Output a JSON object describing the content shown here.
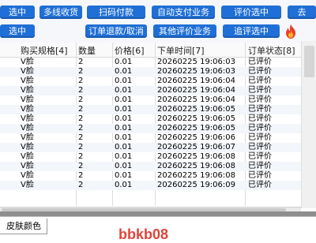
{
  "toolbar": {
    "row1": [
      "选中",
      "多线收货",
      "扫码付款",
      "自动支付业务",
      "评价选中",
      "去"
    ],
    "row2": [
      "选中",
      "订单退款/取消",
      "其他评价业务",
      "追评选中"
    ]
  },
  "table": {
    "columns": [
      "购买规格[4]",
      "数量",
      "价格[6]",
      "下单时间[7]",
      "订单状态[8]"
    ],
    "rows": [
      [
        "V脸",
        "2",
        "0.01",
        "20260225 19:06:03",
        "已评价"
      ],
      [
        "V脸",
        "2",
        "0.01",
        "20260225 19:06:03",
        "已评价"
      ],
      [
        "V脸",
        "2",
        "0.01",
        "20260225 19:06:04",
        "已评价"
      ],
      [
        "V脸",
        "2",
        "0.01",
        "20260225 19:06:04",
        "已评价"
      ],
      [
        "V脸",
        "2",
        "0.01",
        "20260225 19:06:04",
        "已评价"
      ],
      [
        "V脸",
        "2",
        "0.01",
        "20260225 19:06:05",
        "已评价"
      ],
      [
        "V脸",
        "2",
        "0.01",
        "20260225 19:06:05",
        "已评价"
      ],
      [
        "V脸",
        "2",
        "0.01",
        "20260225 19:06:05",
        "已评价"
      ],
      [
        "V脸",
        "2",
        "0.01",
        "20260225 19:06:06",
        "已评价"
      ],
      [
        "V脸",
        "2",
        "0.01",
        "20260225 19:06:07",
        "已评价"
      ],
      [
        "V脸",
        "2",
        "0.01",
        "20260225 19:06:08",
        "已评价"
      ],
      [
        "V脸",
        "2",
        "0.01",
        "20260225 19:06:08",
        "已评价"
      ],
      [
        "V脸",
        "2",
        "0.01",
        "20260225 19:06:08",
        "已评价"
      ],
      [
        "V脸",
        "2",
        "0.01",
        "20260225 19:06:09",
        "已评价"
      ]
    ]
  },
  "bottom": {
    "tab_label": "皮肤颜色",
    "watermark": "bbkb08"
  },
  "colors": {
    "button_bg": "#1f6fd6",
    "button_text": "#ffffff",
    "watermark": "#e0443a"
  },
  "icons": [
    "fire-icon"
  ]
}
